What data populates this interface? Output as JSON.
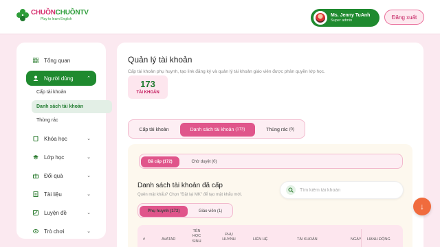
{
  "colors": {
    "brand_green": "#1f8a2f",
    "brand_pink": "#e0558b",
    "bg": "#fbe9f0",
    "fab": "#f06b3d"
  },
  "header": {
    "logo_part1": "CHUỒN",
    "logo_part2": "CHUỒN",
    "logo_part3": "TV",
    "logo_tagline": "Play to learn English",
    "user_name": "Ms. Jenny TuAnh",
    "user_role": "Super admin",
    "logout_label": "Đăng xuất"
  },
  "sidebar": {
    "items": [
      {
        "label": "Tổng quan",
        "icon": "dashboard-icon"
      },
      {
        "label": "Người dùng",
        "icon": "users-icon",
        "expanded": true,
        "active": true
      },
      {
        "label": "Khóa học",
        "icon": "book-icon"
      },
      {
        "label": "Lớp học",
        "icon": "graduation-cap-icon"
      },
      {
        "label": "Đổi quà",
        "icon": "gift-icon"
      },
      {
        "label": "Tài liệu",
        "icon": "document-icon"
      },
      {
        "label": "Luyện đề",
        "icon": "pen-icon"
      },
      {
        "label": "Trò chơi",
        "icon": "game-icon"
      }
    ],
    "subitems": [
      {
        "label": "Cấp tài khoản"
      },
      {
        "label": "Danh sách tài khoản",
        "active": true
      },
      {
        "label": "Thùng rác"
      }
    ]
  },
  "main": {
    "title": "Quản lý tài khoản",
    "description": "Cấp tài khoản phụ huynh, tạo link đăng ký và quản lý tài khoản giáo viên được phân quyền lớp học.",
    "stat_value": "173",
    "stat_label": "TÀI KHOẢN",
    "tabs": [
      {
        "label": "Cấp tài khoản"
      },
      {
        "label": "Danh sách tài khoản",
        "count": "(173)",
        "active": true
      },
      {
        "label": "Thùng rác",
        "count": "(0)"
      }
    ],
    "panel": {
      "status_tabs": [
        {
          "label": "Đã cấp (172)",
          "active": true
        },
        {
          "label": "Chờ duyệt (0)"
        }
      ],
      "section_title": "Danh sách tài khoản đã cấp",
      "section_hint": "Quên mật khẩu? Chọn \"Đặt lại MK\" để tạo mật khẩu mới.",
      "search_placeholder": "Tìm kiếm tài khoản",
      "role_tabs": [
        {
          "label": "Phụ huynh (172)",
          "active": true
        },
        {
          "label": "Giáo viên (1)"
        }
      ],
      "columns": [
        "#",
        "AVATAR",
        "TÊN HỌC SINH",
        "PHỤ HUYNH",
        "LIÊN HỆ",
        "TÀI KHOẢN",
        "NGÀY",
        "HÀNH ĐỘNG"
      ]
    }
  },
  "fab_icon": "arrow-down-icon"
}
